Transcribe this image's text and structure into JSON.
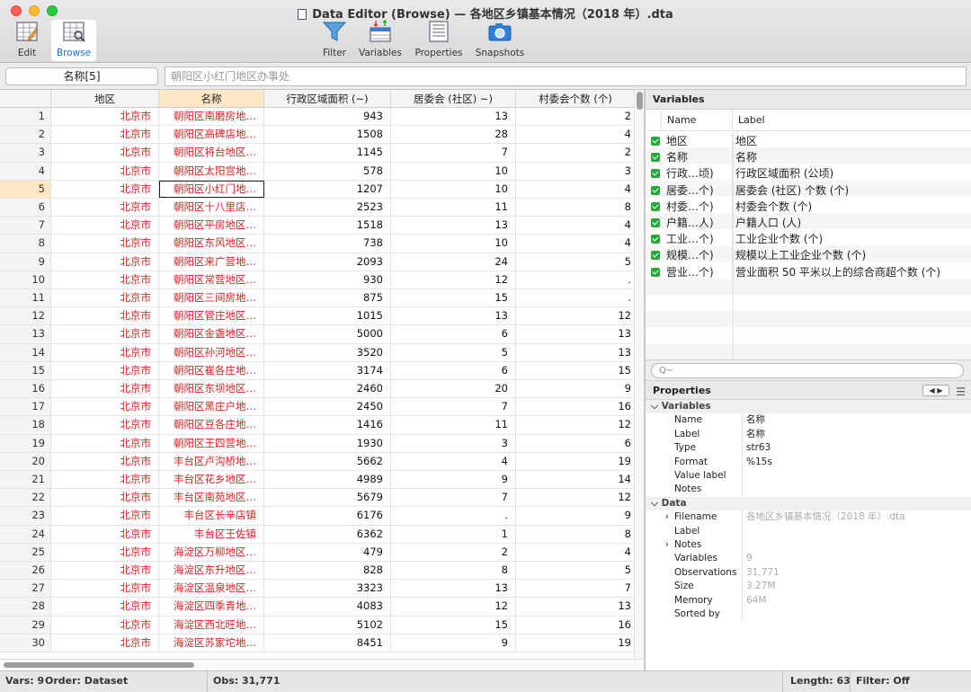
{
  "window": {
    "title": "Data Editor (Browse) — 各地区乡镇基本情况（2018 年）.dta"
  },
  "toolbar": {
    "edit": "Edit",
    "browse": "Browse",
    "filter": "Filter",
    "variables": "Variables",
    "properties": "Properties",
    "snapshots": "Snapshots"
  },
  "editbar": {
    "varname": "名称[5]",
    "value": "朝阳区小红门地区办事处"
  },
  "grid": {
    "columns": [
      "地区",
      "名称",
      "行政区域面积 (~)",
      "居委会 (社区) ~)",
      "村委会个数 (个)"
    ],
    "rows": [
      [
        "1",
        "北京市",
        "朝阳区南磨房地…",
        "943",
        "13",
        "2"
      ],
      [
        "2",
        "北京市",
        "朝阳区高碑店地…",
        "1508",
        "28",
        "4"
      ],
      [
        "3",
        "北京市",
        "朝阳区将台地区…",
        "1145",
        "7",
        "2"
      ],
      [
        "4",
        "北京市",
        "朝阳区太阳宫地…",
        "578",
        "10",
        "3"
      ],
      [
        "5",
        "北京市",
        "朝阳区小红门地…",
        "1207",
        "10",
        "4"
      ],
      [
        "6",
        "北京市",
        "朝阳区十八里店…",
        "2523",
        "11",
        "8"
      ],
      [
        "7",
        "北京市",
        "朝阳区平房地区…",
        "1518",
        "13",
        "4"
      ],
      [
        "8",
        "北京市",
        "朝阳区东风地区…",
        "738",
        "10",
        "4"
      ],
      [
        "9",
        "北京市",
        "朝阳区来广营地…",
        "2093",
        "24",
        "5"
      ],
      [
        "10",
        "北京市",
        "朝阳区常营地区…",
        "930",
        "12",
        "."
      ],
      [
        "11",
        "北京市",
        "朝阳区三间房地…",
        "875",
        "15",
        "."
      ],
      [
        "12",
        "北京市",
        "朝阳区管庄地区…",
        "1015",
        "13",
        "12"
      ],
      [
        "13",
        "北京市",
        "朝阳区金盏地区…",
        "5000",
        "6",
        "13"
      ],
      [
        "14",
        "北京市",
        "朝阳区孙河地区…",
        "3520",
        "5",
        "13"
      ],
      [
        "15",
        "北京市",
        "朝阳区崔各庄地…",
        "3174",
        "6",
        "15"
      ],
      [
        "16",
        "北京市",
        "朝阳区东坝地区…",
        "2460",
        "20",
        "9"
      ],
      [
        "17",
        "北京市",
        "朝阳区黑庄户地…",
        "2450",
        "7",
        "16"
      ],
      [
        "18",
        "北京市",
        "朝阳区豆各庄地…",
        "1416",
        "11",
        "12"
      ],
      [
        "19",
        "北京市",
        "朝阳区王四营地…",
        "1930",
        "3",
        "6"
      ],
      [
        "20",
        "北京市",
        "丰台区卢沟桥地…",
        "5662",
        "4",
        "19"
      ],
      [
        "21",
        "北京市",
        "丰台区花乡地区…",
        "4989",
        "9",
        "14"
      ],
      [
        "22",
        "北京市",
        "丰台区南苑地区…",
        "5679",
        "7",
        "12"
      ],
      [
        "23",
        "北京市",
        "丰台区长辛店镇",
        "6176",
        ".",
        "9"
      ],
      [
        "24",
        "北京市",
        "丰台区王佐镇",
        "6362",
        "1",
        "8"
      ],
      [
        "25",
        "北京市",
        "海淀区万柳地区…",
        "479",
        "2",
        "4"
      ],
      [
        "26",
        "北京市",
        "海淀区东升地区…",
        "828",
        "8",
        "5"
      ],
      [
        "27",
        "北京市",
        "海淀区温泉地区…",
        "3323",
        "13",
        "7"
      ],
      [
        "28",
        "北京市",
        "海淀区四季青地…",
        "4083",
        "12",
        "13"
      ],
      [
        "29",
        "北京市",
        "海淀区西北旺地…",
        "5102",
        "15",
        "16"
      ],
      [
        "30",
        "北京市",
        "海淀区苏家坨地…",
        "8451",
        "9",
        "19"
      ]
    ]
  },
  "variables": {
    "title": "Variables",
    "header_name": "Name",
    "header_label": "Label",
    "items": [
      {
        "name": "地区",
        "label": "地区"
      },
      {
        "name": "名称",
        "label": "名称"
      },
      {
        "name": "行政…顷)",
        "label": "行政区域面积 (公顷)"
      },
      {
        "name": "居委…个)",
        "label": "居委会 (社区) 个数 (个)"
      },
      {
        "name": "村委…个)",
        "label": "村委会个数 (个)"
      },
      {
        "name": "户籍…人)",
        "label": "户籍人口 (人)"
      },
      {
        "name": "工业…个)",
        "label": "工业企业个数 (个)"
      },
      {
        "name": "规模…个)",
        "label": "规模以上工业企业个数 (个)"
      },
      {
        "name": "营业…个)",
        "label": "营业面积 50 平米以上的综合商超个数 (个)"
      }
    ],
    "search_placeholder": "Q~"
  },
  "properties": {
    "title": "Properties",
    "sec_variables": "Variables",
    "var_rows": [
      [
        "Name",
        "名称"
      ],
      [
        "Label",
        "名称"
      ],
      [
        "Type",
        "str63"
      ],
      [
        "Format",
        "%15s"
      ],
      [
        "Value label",
        ""
      ],
      [
        "Notes",
        ""
      ]
    ],
    "sec_data": "Data",
    "data_rows": [
      [
        "Filename",
        "各地区乡镇基本情况（2018 年）.dta"
      ],
      [
        "Label",
        ""
      ],
      [
        "Notes",
        ""
      ],
      [
        "Variables",
        "9"
      ],
      [
        "Observations",
        "31,771"
      ],
      [
        "Size",
        "3.27M"
      ],
      [
        "Memory",
        "64M"
      ],
      [
        "Sorted by",
        ""
      ]
    ]
  },
  "status": {
    "vars": "Vars: 9",
    "order": "Order: Dataset",
    "obs": "Obs: 31,771",
    "length": "Length: 63",
    "filter": "Filter: Off"
  }
}
